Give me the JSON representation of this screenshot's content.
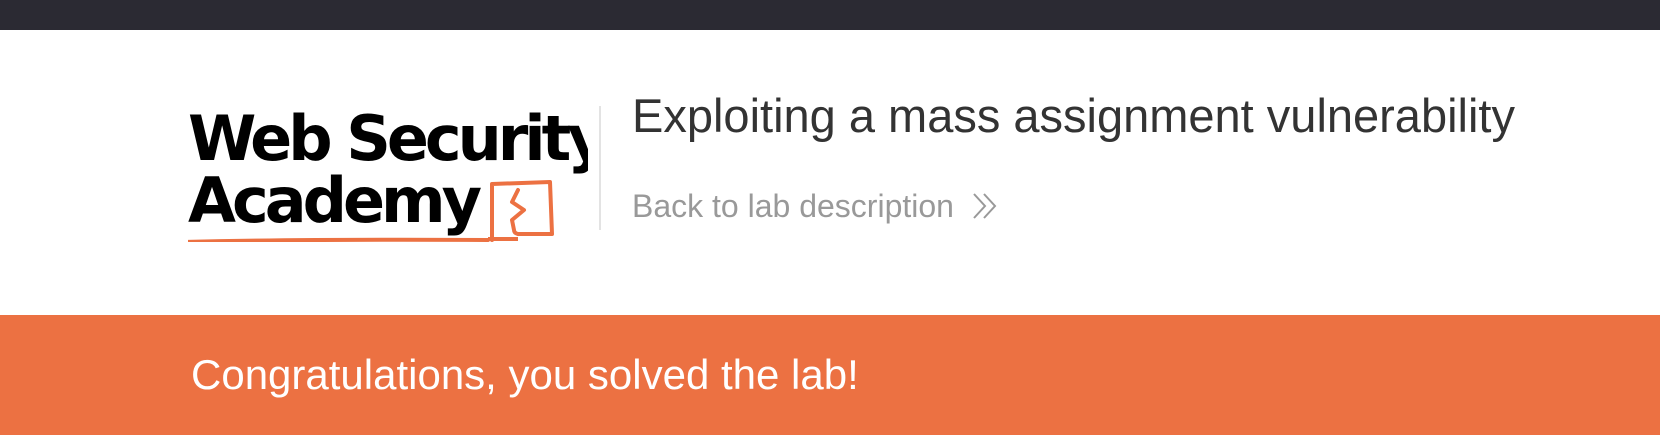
{
  "logo": {
    "line1": "Web Security",
    "line2": "Academy",
    "icon": "academy-logo-mark",
    "accent_color": "#ec7142"
  },
  "lab": {
    "title": "Exploiting a mass assignment vulnerability",
    "back_link_label": "Back to lab description",
    "back_icon": "double-chevron-right-icon"
  },
  "banner": {
    "message": "Congratulations, you solved the lab!",
    "color": "#ec7142"
  },
  "colors": {
    "topbar": "#2b2a33",
    "title_text": "#333333",
    "link_text": "#999999"
  }
}
